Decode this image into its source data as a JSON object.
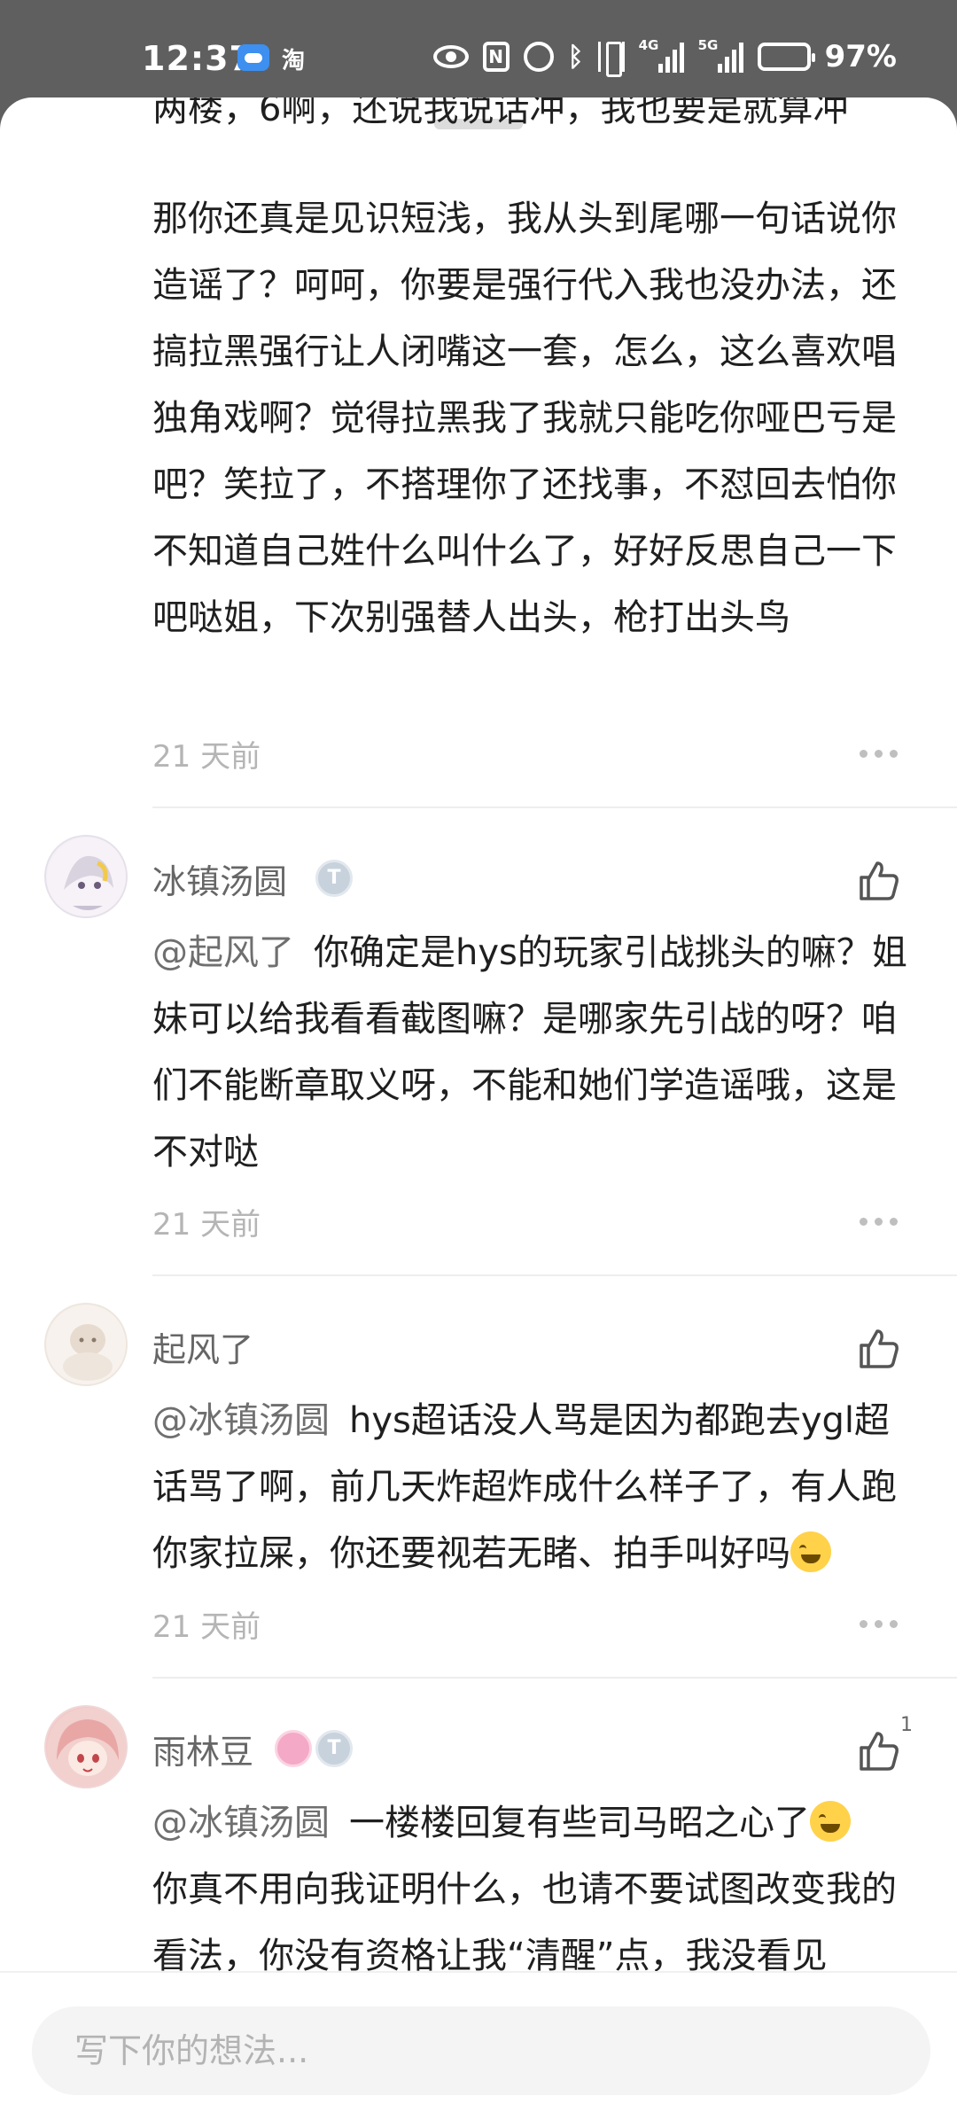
{
  "status_bar": {
    "time": "12:37",
    "app_indicator": "淘",
    "network_left": "4G",
    "network_right": "5G",
    "battery": "97%",
    "icons": [
      "cloud-icon",
      "eye-icon",
      "nfc-icon",
      "alarm-icon",
      "bluetooth-icon",
      "vibrate-icon",
      "signal-icon",
      "battery-icon"
    ]
  },
  "comments": [
    {
      "partial_top_line": "两楼，6啊，还说我说话冲，我也要是就算冲",
      "text": "那你还真是见识短浅，我从头到尾哪一句话说你造谣了？呵呵，你要是强行代入我也没办法，还搞拉黑强行让人闭嘴这一套，怎么，这么喜欢唱独角戏啊？觉得拉黑我了我就只能吃你哑巴亏是吧？笑拉了，不搭理你了还找事，不怼回去怕你不知道自己姓什么叫什么了，好好反思自己一下吧哒姐，下次别强替人出头，枪打出头鸟",
      "time": "21 天前"
    },
    {
      "user": "冰镇汤圆",
      "mention": "@起风了",
      "text": "你确定是hys的玩家引战挑头的嘛？姐妹可以给我看看截图嘛？是哪家先引战的呀？咱们不能断章取义呀，不能和她们学造谣哦，这是不对哒",
      "time": "21 天前"
    },
    {
      "user": "起风了",
      "mention": "@冰镇汤圆",
      "text": "hys超话没人骂是因为都跑去ygl超话骂了啊，前几天炸超炸成什么样子了，有人跑你家拉屎，你还要视若无睹、拍手叫好吗",
      "time": "21 天前"
    },
    {
      "user": "雨林豆",
      "mention": "@冰镇汤圆",
      "text": "一楼楼回复有些司马昭之心了",
      "text2": "你真不用向我证明什么，也请不要试图改变我的看法，你没有资格让我“清醒”点，我没看见",
      "likes": "1"
    }
  ],
  "input": {
    "placeholder": "写下你的想法..."
  },
  "colors": {
    "status_bg": "#5f5f5f",
    "sheet_bg": "#ffffff",
    "text_primary": "#1f1f1f",
    "text_secondary": "#6f6f6f",
    "text_time": "#b5b5b5"
  }
}
